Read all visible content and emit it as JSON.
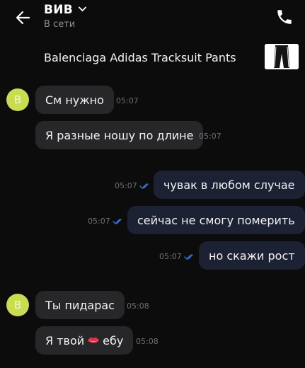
{
  "header": {
    "chat_name": "ВИВ",
    "status": "В сети"
  },
  "product": {
    "title": "Balenciaga Adidas Tracksuit Pants"
  },
  "messages": [
    {
      "direction": "in",
      "text": "См нужно",
      "time": "05:07",
      "avatar": "В"
    },
    {
      "direction": "in",
      "text": "Я разные ношу по длине",
      "time": "05:07"
    },
    {
      "direction": "out",
      "text": "чувак в любом случае",
      "time": "05:07",
      "read": true
    },
    {
      "direction": "out",
      "text": "сейчас не смогу померить",
      "time": "05:07",
      "read": true
    },
    {
      "direction": "out",
      "text": "но скажи рост",
      "time": "05:07",
      "read": true
    },
    {
      "direction": "in",
      "text": "Ты пидарас",
      "time": "05:08",
      "avatar": "В"
    },
    {
      "direction": "in",
      "text_before": "Я твой",
      "emoji": "lips-emoji",
      "text_after": "ебу",
      "time": "05:08"
    }
  ],
  "colors": {
    "background": "#0c0c0d",
    "incoming_bubble": "#27272a",
    "outgoing_bubble": "#1c2233",
    "avatar": "#c9dc52",
    "read_check": "#3d6fd0"
  },
  "icons": {
    "back": "arrow-left-icon",
    "phone": "phone-icon",
    "chevron": "chevron-down-icon",
    "read": "double-check-icon"
  }
}
